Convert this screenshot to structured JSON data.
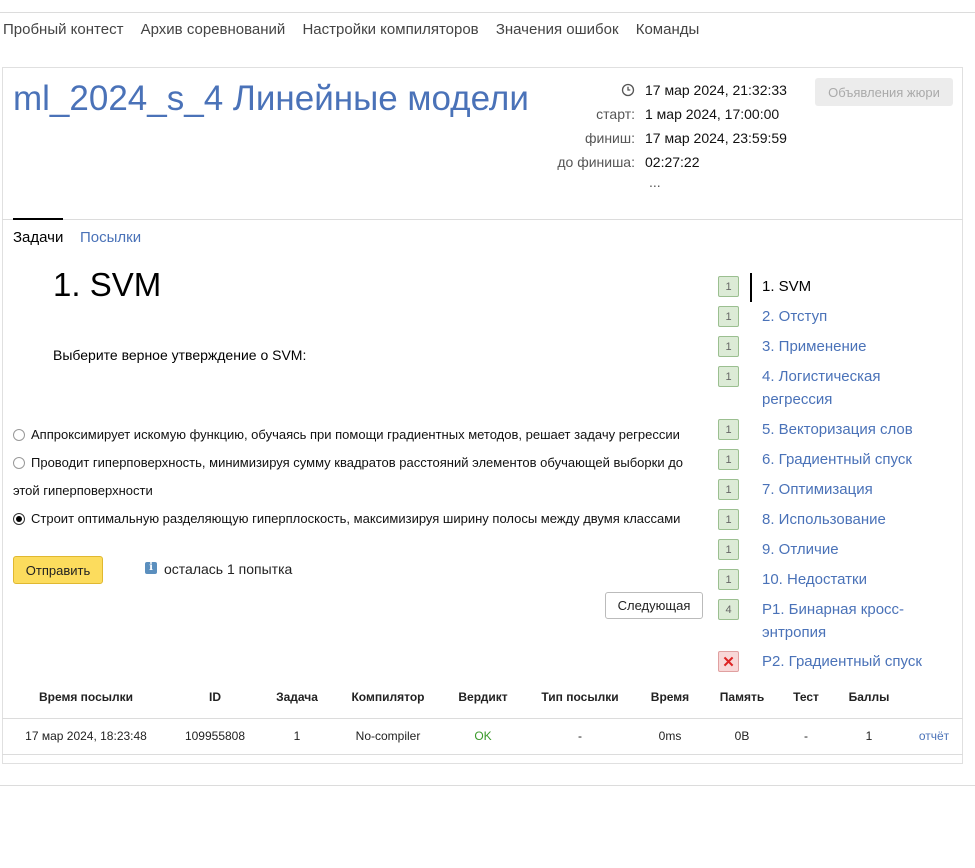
{
  "nav": [
    "Пробный контест",
    "Архив соревнований",
    "Настройки компиляторов",
    "Значения ошибок",
    "Команды"
  ],
  "contest": {
    "title": "ml_2024_s_4 Линейные модели",
    "current_time": "17 мар 2024, 21:32:33",
    "start_label": "старт:",
    "start_value": "1 мар 2024, 17:00:00",
    "finish_label": "финиш:",
    "finish_value": "17 мар 2024, 23:59:59",
    "remaining_label": "до финиша:",
    "remaining_value": "02:27:22",
    "more": "...",
    "jury_button": "Объявления жюри"
  },
  "tabs": {
    "tasks": "Задачи",
    "submissions": "Посылки"
  },
  "problem": {
    "heading": "1. SVM",
    "question": "Выберите верное утверждение о SVM:",
    "options": [
      "Аппроксимирует искомую функцию, обучаясь при помощи градиентных методов, решает задачу регрессии",
      "Проводит гиперповерхность, минимизируя сумму квадратов расстояний элементов обучающей выборки до этой гиперповерхности",
      "Строит оптимальную разделяющую гиперплоскость, максимизируя ширину полосы между двумя классами"
    ],
    "selected_option": 2,
    "submit_button": "Отправить",
    "info_icon": "i",
    "attempts_left": "осталась 1 попытка",
    "next_button": "Следующая"
  },
  "problems": [
    {
      "badge": "1",
      "label": "1. SVM"
    },
    {
      "badge": "1",
      "label": "2. Отступ"
    },
    {
      "badge": "1",
      "label": "3. Применение"
    },
    {
      "badge": "1",
      "label": "4. Логистическая регрессия"
    },
    {
      "badge": "1",
      "label": "5. Векторизация слов"
    },
    {
      "badge": "1",
      "label": "6. Градиентный спуск"
    },
    {
      "badge": "1",
      "label": "7. Оптимизация"
    },
    {
      "badge": "1",
      "label": "8. Использование"
    },
    {
      "badge": "1",
      "label": "9. Отличие"
    },
    {
      "badge": "1",
      "label": "10. Недостатки"
    },
    {
      "badge": "4",
      "label": "P1. Бинарная кросс-энтропия"
    },
    {
      "badge": "✕",
      "label": "P2. Градиентный спуск"
    }
  ],
  "table": {
    "headers": [
      "Время посылки",
      "ID",
      "Задача",
      "Компилятор",
      "Вердикт",
      "Тип посылки",
      "Время",
      "Память",
      "Тест",
      "Баллы"
    ],
    "row": [
      "17 мар 2024, 18:23:48",
      "109955808",
      "1",
      "No-compiler",
      "OK",
      "-",
      "0ms",
      "0B",
      "-",
      "1"
    ],
    "report_link": "отчёт"
  },
  "colors": {
    "link": "#4a72b8",
    "ok": "#3a9a2a",
    "accent_button": "#fcdc5d"
  }
}
